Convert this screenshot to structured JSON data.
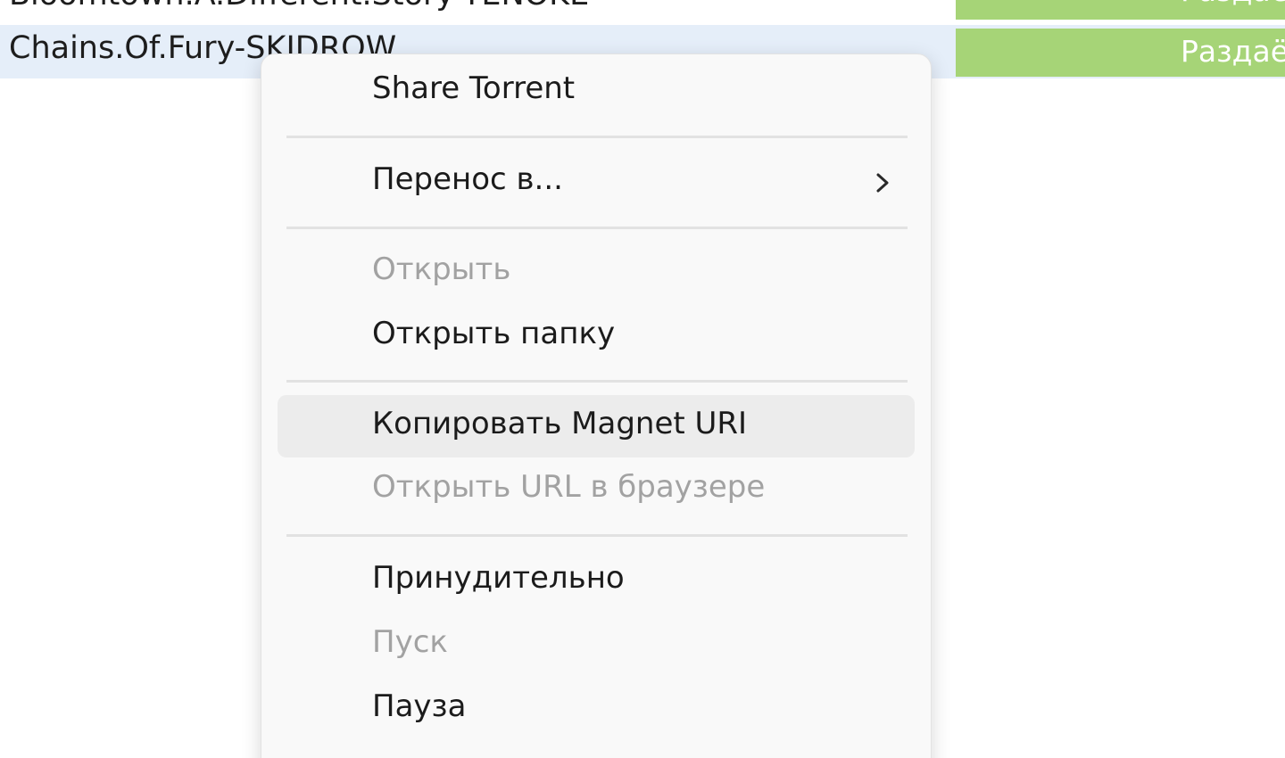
{
  "torrent_list": {
    "rows": [
      {
        "name": "Bloomtown.A.Different.Story-TENOKE",
        "status": "Раздаё"
      },
      {
        "name": "Chains.Of.Fury-SKIDROW",
        "status": "Раздаё"
      }
    ],
    "colors": {
      "selected_row_bg": "#e5eef9",
      "seeding_status_bg": "#a6d477"
    }
  },
  "context_menu": {
    "items": [
      {
        "label": "Share Torrent",
        "enabled": true
      },
      {
        "label": "Перенос в...",
        "enabled": true,
        "submenu": true,
        "icon": "chevron-right-icon"
      },
      {
        "label": "Открыть",
        "enabled": false
      },
      {
        "label": "Открыть папку",
        "enabled": true
      },
      {
        "label": "Копировать Magnet URI",
        "enabled": true,
        "highlighted": true
      },
      {
        "label": "Открыть URL в браузере",
        "enabled": false
      },
      {
        "label": "Принудительно",
        "enabled": true
      },
      {
        "label": "Пуск",
        "enabled": false
      },
      {
        "label": "Пауза",
        "enabled": true
      }
    ]
  }
}
